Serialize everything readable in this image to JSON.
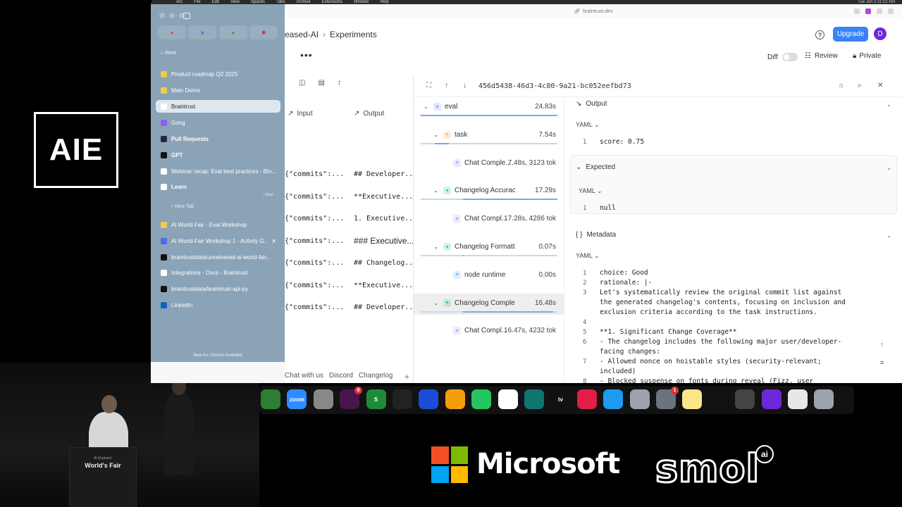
{
  "overlay": {
    "aie_logo": "AIE",
    "podium_small": "Ai Engineer",
    "podium_label": "World's Fair",
    "microsoft": "Microsoft",
    "smol": "smol",
    "smol_ai": "ai"
  },
  "menubar": {
    "items": [
      "Arc",
      "File",
      "Edit",
      "View",
      "Spaces",
      "Tabs",
      "Archive",
      "Extensions",
      "Window",
      "Help"
    ],
    "clock": "Tue Jun 3  11:51 AM"
  },
  "sidebar": {
    "space_label": "Work",
    "items": [
      {
        "label": "Product roadmap Q2 2025",
        "icon_color": "#f2c94c"
      },
      {
        "label": "Main Demo",
        "icon_color": "#f2c94c"
      },
      {
        "label": "Braintrust",
        "icon_color": "#ffffff"
      },
      {
        "label": "Gong",
        "icon_color": "#8b5cf6"
      },
      {
        "label": "Pull Requests",
        "icon_color": "#1f2937"
      },
      {
        "label": "GPT",
        "icon_color": "#111111"
      },
      {
        "label": "Webinar recap: Eval best practices - Blo...",
        "icon_color": "#ffffff"
      },
      {
        "label": "Learn",
        "icon_color": "#ffffff"
      }
    ],
    "clear_label": "↓ Clear",
    "new_tab": "+ New Tab",
    "tabs": [
      {
        "label": "AI World Fair - Eval Workshop",
        "icon_color": "#f2c94c"
      },
      {
        "label": "AI World Fair Workshop 1 - Activity G...",
        "icon_color": "#4f6bed"
      },
      {
        "label": "braintrustdata/unreleased-ai-world-fair...",
        "icon_color": "#111111"
      },
      {
        "label": "Integrations - Docs - Braintrust",
        "icon_color": "#ffffff"
      },
      {
        "label": "braintrustdata/braintrust-api-py",
        "icon_color": "#111111"
      },
      {
        "label": "LinkedIn",
        "icon_color": "#0a66c2"
      }
    ],
    "update": "New Arc Version Available"
  },
  "browser": {
    "url": "braintrust.dev",
    "breadcrumb": [
      "eased-AI",
      "Experiments"
    ],
    "upgrade": "Upgrade",
    "avatar": "D",
    "diff": "Diff",
    "review": "Review",
    "private": "Private"
  },
  "table": {
    "col_input": "Input",
    "col_output": "Output",
    "rows": [
      {
        "input": "{\"commits\":...",
        "output": "## Developer..."
      },
      {
        "input": "{\"commits\":...",
        "output": "**Executive..."
      },
      {
        "input": "{\"commits\":...",
        "output": "1. Executive..."
      },
      {
        "input": "{\"commits\":...",
        "output": "### Executive..."
      },
      {
        "input": "{\"commits\":...",
        "output": "## Changelog..."
      },
      {
        "input": "{\"commits\":...",
        "output": "**Executive..."
      },
      {
        "input": "{\"commits\":...",
        "output": "## Developer..."
      }
    ]
  },
  "trace": {
    "id": "456d5438-46d3-4c80-9a21-bc052eefbd73",
    "spans": [
      {
        "name": "eval",
        "duration": "24.83s",
        "icon_color": "#6b8cff"
      },
      {
        "name": "task",
        "duration": "7.54s",
        "icon_color": "#f0a35b"
      },
      {
        "name": "Chat Comple...",
        "duration": "7.48s, 3123 tok",
        "icon_color": "#a78bfa"
      },
      {
        "name": "Changelog Accuracy S...",
        "duration": "17.29s",
        "icon_color": "#22c55e"
      },
      {
        "name": "Chat Compl...",
        "duration": "17.28s, 4286 tok",
        "icon_color": "#a78bfa"
      },
      {
        "name": "Changelog Formatting S...",
        "duration": "0.07s",
        "icon_color": "#22c55e"
      },
      {
        "name": "node runtime",
        "duration": "0.00s",
        "icon_color": "#60a5fa"
      },
      {
        "name": "Changelog Completen...",
        "duration": "16.48s",
        "icon_color": "#22c55e"
      },
      {
        "name": "Chat Compl...",
        "duration": "16.47s, 4232 tok",
        "icon_color": "#a78bfa"
      }
    ],
    "output_title": "Output",
    "yaml": "YAML",
    "output_line": "score: 0.75",
    "expected_title": "Expected",
    "expected_line": "null",
    "metadata_title": "Metadata",
    "metadata_lines": [
      {
        "n": "1",
        "text": "choice: Good"
      },
      {
        "n": "2",
        "text": "rationale: |-"
      },
      {
        "n": "3",
        "text": "  Let's systematically review the original commit list against"
      },
      {
        "n": "",
        "text": "  the generated changelog's contents, focusing on inclusion and"
      },
      {
        "n": "",
        "text": "  exclusion criteria according to the task instructions."
      },
      {
        "n": "4",
        "text": ""
      },
      {
        "n": "5",
        "text": "  **1. Significant Change Coverage**"
      },
      {
        "n": "6",
        "text": "  - The changelog includes the following major user/developer-"
      },
      {
        "n": "",
        "text": "  facing changes:"
      },
      {
        "n": "7",
        "text": "    - Allowed nonce on hoistable styles (security-relevant;"
      },
      {
        "n": "",
        "text": "    included)"
      },
      {
        "n": "8",
        "text": "    - Blocked suspense on fonts during reveal (Fizz, user"
      }
    ]
  },
  "footer_links": [
    "Chat with us",
    "Discord",
    "Changelog"
  ],
  "dock": {
    "apps": [
      {
        "label": "",
        "color": "#2e7d32"
      },
      {
        "label": "zoom",
        "color": "#2d8cff"
      },
      {
        "label": "",
        "color": "#888888"
      },
      {
        "label": "",
        "color": "#4a154b",
        "badge": "6"
      },
      {
        "label": "S",
        "color": "#1f8a3b"
      },
      {
        "label": "",
        "color": "#222222"
      },
      {
        "label": "",
        "color": "#1a4ed8"
      },
      {
        "label": "",
        "color": "#f59e0b"
      },
      {
        "label": "",
        "color": "#22c55e"
      },
      {
        "label": "",
        "color": "#ffffff"
      },
      {
        "label": "",
        "color": "#0f766e"
      },
      {
        "label": "tv",
        "color": "#111111"
      },
      {
        "label": "",
        "color": "#e11d48"
      },
      {
        "label": "",
        "color": "#1d9bf0"
      },
      {
        "label": "",
        "color": "#9ca3af"
      },
      {
        "label": "",
        "color": "#6b7280",
        "badge": "1"
      },
      {
        "label": "",
        "color": "#fde68a"
      },
      {
        "label": "",
        "color": "#111111"
      },
      {
        "label": "",
        "color": "#444444"
      },
      {
        "label": "",
        "color": "#6d28d9"
      },
      {
        "label": "",
        "color": "#e5e7eb"
      },
      {
        "label": "",
        "color": "#9ca3af"
      }
    ]
  }
}
